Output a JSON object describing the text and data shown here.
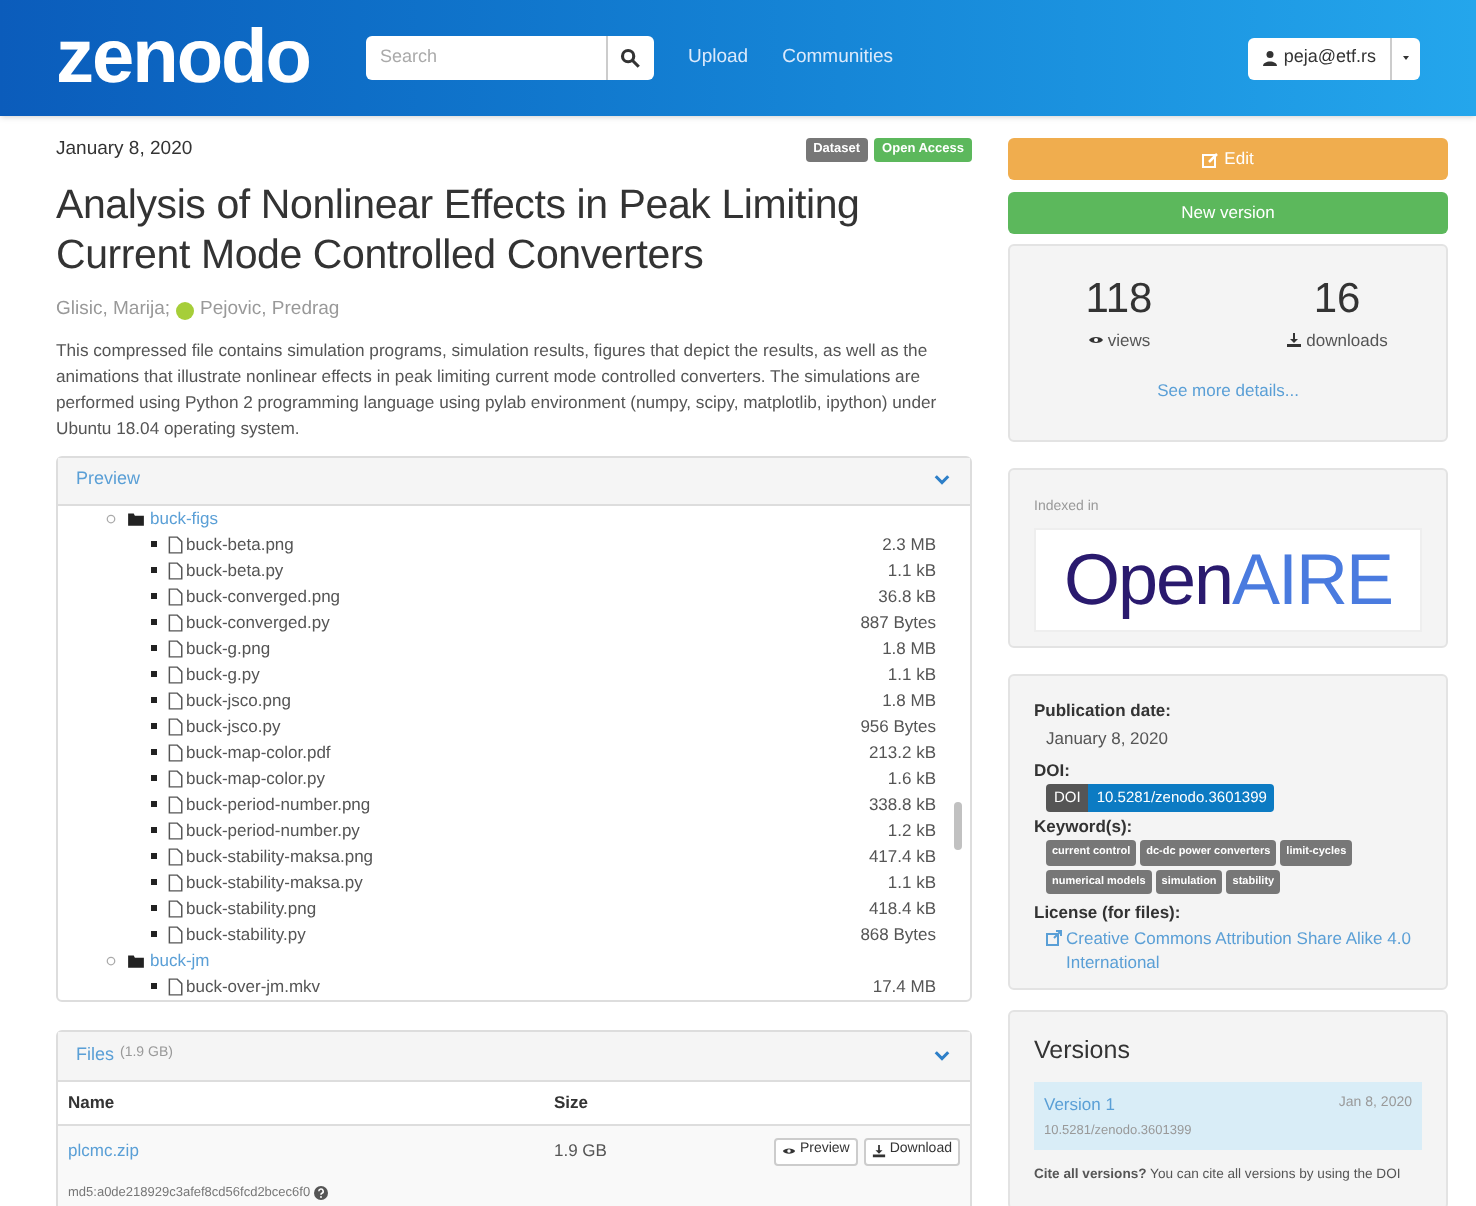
{
  "header": {
    "logo": "zenodo",
    "search": {
      "placeholder": "Search"
    },
    "nav": [
      "Upload",
      "Communities"
    ],
    "user": "peja@etf.rs"
  },
  "record": {
    "date": "January 8, 2020",
    "badges": [
      {
        "label": "Dataset",
        "color": "#777777"
      },
      {
        "label": "Open Access",
        "color": "#5cb85c"
      }
    ],
    "title": "Analysis of Nonlinear Effects in Peak Limiting Current Mode Controlled Converters",
    "authors": [
      {
        "name": "Glisic, Marija;",
        "orcid": false
      },
      {
        "name": "Pejovic, Predrag",
        "orcid": true
      }
    ],
    "description": "This compressed file contains simulation programs, simulation results, figures that depict the results, as well as the animations that illustrate nonlinear effects in peak limiting current mode controlled converters. The simulations are performed using Python 2 programming language using pylab environment (numpy, scipy, matplotlib, ipython) under Ubuntu 18.04 operating system."
  },
  "preview": {
    "title": "Preview",
    "tree": [
      {
        "name": "buck-figs",
        "kind": "folder",
        "children": [
          {
            "name": "buck-beta.png",
            "kind": "file",
            "size": "2.3 MB"
          },
          {
            "name": "buck-beta.py",
            "kind": "file",
            "size": "1.1 kB"
          },
          {
            "name": "buck-converged.png",
            "kind": "file",
            "size": "36.8 kB"
          },
          {
            "name": "buck-converged.py",
            "kind": "file",
            "size": "887 Bytes"
          },
          {
            "name": "buck-g.png",
            "kind": "file",
            "size": "1.8 MB"
          },
          {
            "name": "buck-g.py",
            "kind": "file",
            "size": "1.1 kB"
          },
          {
            "name": "buck-jsco.png",
            "kind": "file",
            "size": "1.8 MB"
          },
          {
            "name": "buck-jsco.py",
            "kind": "file",
            "size": "956 Bytes"
          },
          {
            "name": "buck-map-color.pdf",
            "kind": "file",
            "size": "213.2 kB"
          },
          {
            "name": "buck-map-color.py",
            "kind": "file",
            "size": "1.6 kB"
          },
          {
            "name": "buck-period-number.png",
            "kind": "file",
            "size": "338.8 kB"
          },
          {
            "name": "buck-period-number.py",
            "kind": "file",
            "size": "1.2 kB"
          },
          {
            "name": "buck-stability-maksa.png",
            "kind": "file",
            "size": "417.4 kB"
          },
          {
            "name": "buck-stability-maksa.py",
            "kind": "file",
            "size": "1.1 kB"
          },
          {
            "name": "buck-stability.png",
            "kind": "file",
            "size": "418.4 kB"
          },
          {
            "name": "buck-stability.py",
            "kind": "file",
            "size": "868 Bytes"
          }
        ]
      },
      {
        "name": "buck-jm",
        "kind": "folder",
        "children": [
          {
            "name": "buck-over-jm.mkv",
            "kind": "file",
            "size": "17.4 MB"
          }
        ]
      }
    ]
  },
  "files": {
    "title": "Files",
    "total": "(1.9 GB)",
    "columns": [
      "Name",
      "Size"
    ],
    "rows": [
      {
        "name": "plcmc.zip",
        "size": "1.9 GB",
        "actions": [
          "Preview",
          "Download"
        ],
        "checksum": "md5:a0de218929c3afef8cd56fcd2bcec6f0"
      }
    ]
  },
  "actions": [
    "Edit",
    "New version"
  ],
  "stats": {
    "views": "118",
    "views_label": "views",
    "downloads": "16",
    "downloads_label": "downloads",
    "link": "See more details..."
  },
  "indexed": {
    "label": "Indexed in",
    "logo_1": "Open",
    "logo_2": "AIRE"
  },
  "metadata": {
    "publication_label": "Publication date:",
    "publication_date": "January 8, 2020",
    "doi_label": "DOI:",
    "doi_tag": "DOI",
    "doi": "10.5281/zenodo.3601399",
    "keywords_label": "Keyword(s):",
    "keywords": [
      "current control",
      "dc-dc power converters",
      "limit-cycles",
      "numerical models",
      "simulation",
      "stability"
    ],
    "license_label": "License (for files):",
    "license": "Creative Commons Attribution Share Alike 4.0 International"
  },
  "versions": {
    "title": "Versions",
    "items": [
      {
        "name": "Version 1",
        "date": "Jan 8, 2020",
        "doi": "10.5281/zenodo.3601399",
        "selected": true
      }
    ],
    "note": "**Cite all versions?** You can cite all versions by using the DOI"
  }
}
